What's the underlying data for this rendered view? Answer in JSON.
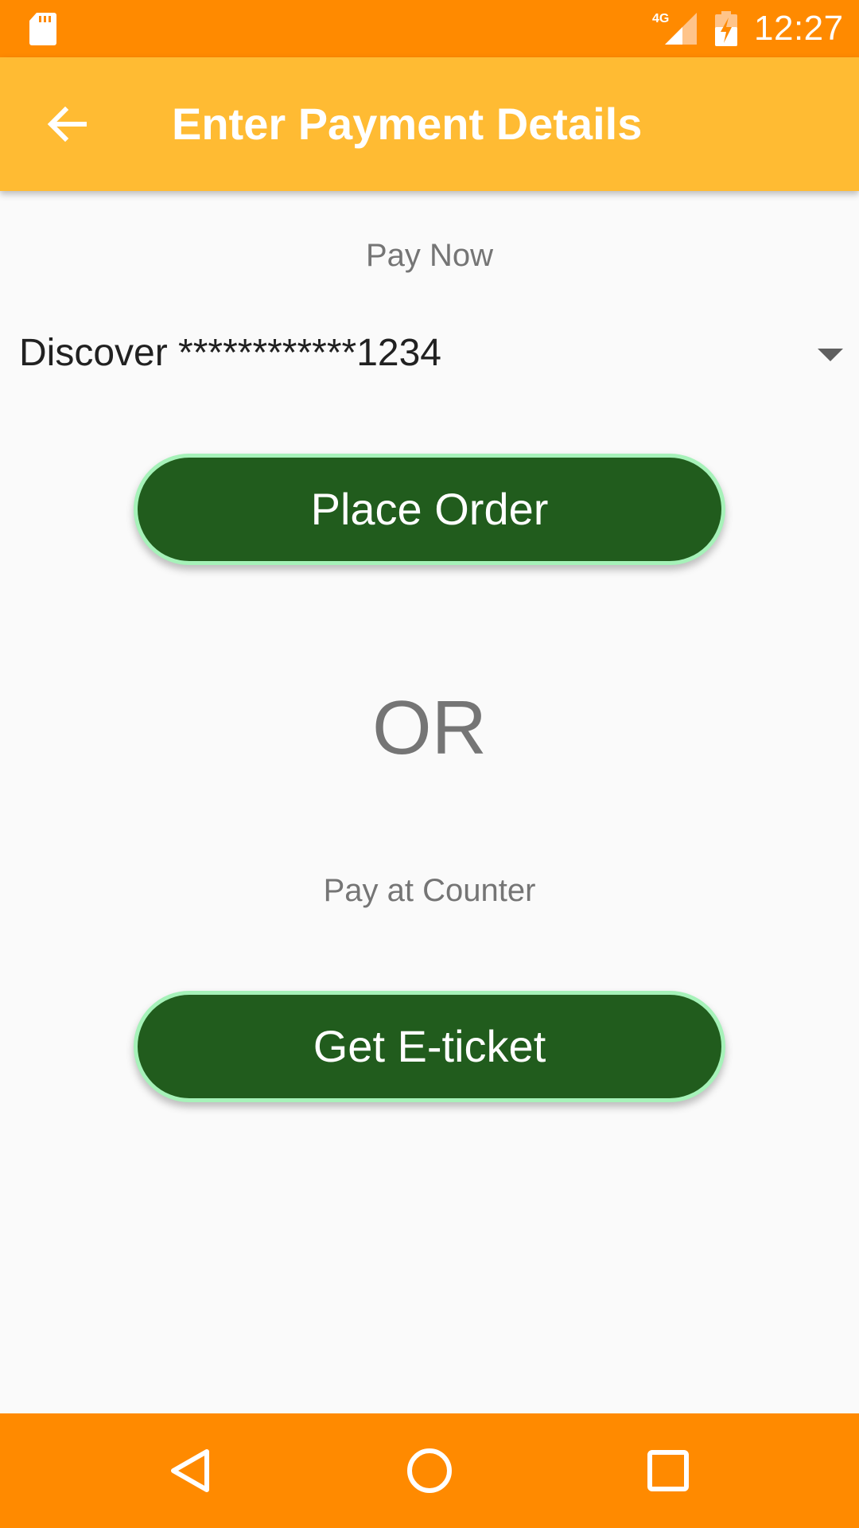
{
  "status_bar": {
    "time": "12:27",
    "network": "4G",
    "sd_card_icon": "sd-card-icon",
    "signal_icon": "signal-icon",
    "battery_icon": "battery-charging-icon",
    "background": "#ff8a00"
  },
  "app_bar": {
    "back_icon": "arrow-back-icon",
    "title": "Enter Payment Details",
    "background": "#ffbb33"
  },
  "payment": {
    "pay_now_label": "Pay Now",
    "selected_card": "Discover ************1234",
    "place_order_label": "Place Order",
    "or_label": "OR",
    "pay_at_counter_label": "Pay at Counter",
    "get_eticket_label": "Get E-ticket",
    "button_color": "#215c1d",
    "button_border_color": "#a6f2b9"
  },
  "nav_bar": {
    "back_icon": "nav-back-icon",
    "home_icon": "nav-home-icon",
    "recents_icon": "nav-recents-icon",
    "background": "#ff8a00"
  }
}
